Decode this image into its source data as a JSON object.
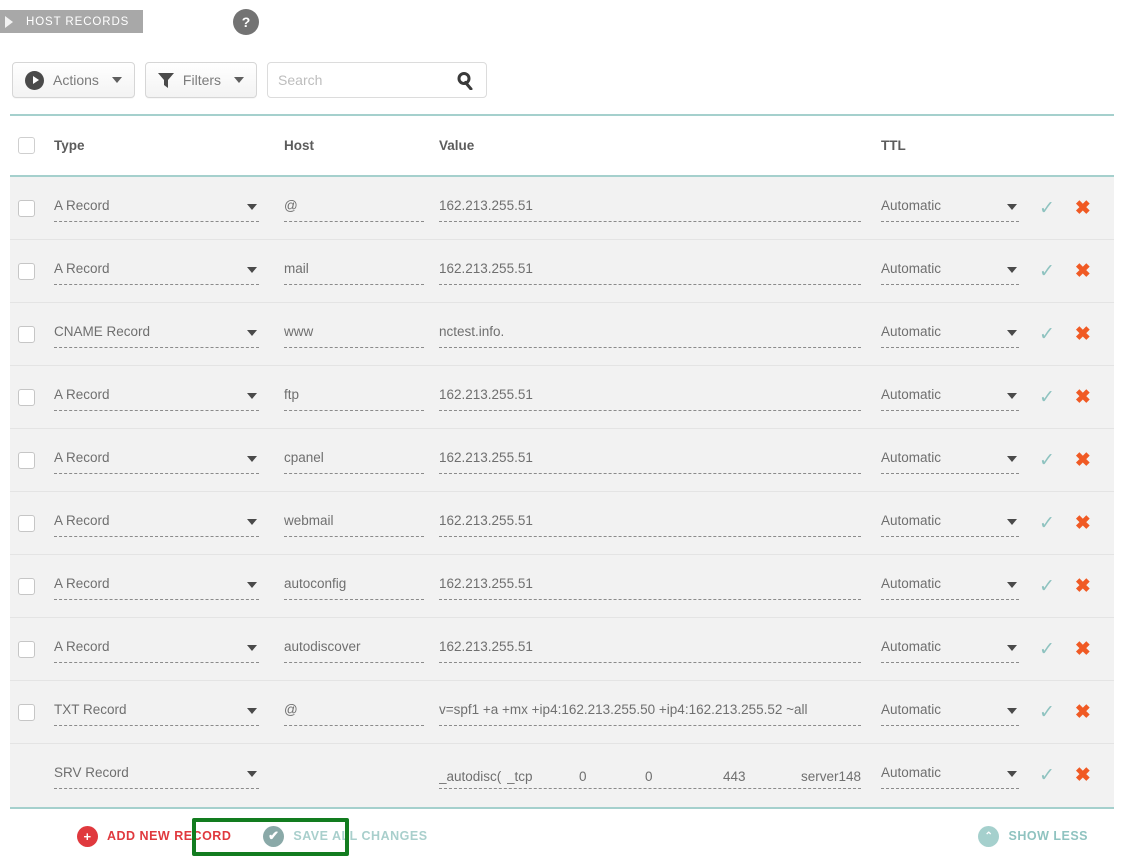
{
  "breadcrumb": {
    "label": "HOST RECORDS"
  },
  "help": {
    "label": "?"
  },
  "toolbar": {
    "actions_label": "Actions",
    "filters_label": "Filters",
    "search_placeholder": "Search",
    "search_value": ""
  },
  "table": {
    "columns": [
      "Type",
      "Host",
      "Value",
      "TTL"
    ],
    "rows": [
      {
        "checkbox": true,
        "type": "A Record",
        "host": "@",
        "value": "162.213.255.51",
        "ttl": "Automatic"
      },
      {
        "checkbox": true,
        "type": "A Record",
        "host": "mail",
        "value": "162.213.255.51",
        "ttl": "Automatic"
      },
      {
        "checkbox": true,
        "type": "CNAME Record",
        "host": "www",
        "value": "nctest.info.",
        "ttl": "Automatic"
      },
      {
        "checkbox": true,
        "type": "A Record",
        "host": "ftp",
        "value": "162.213.255.51",
        "ttl": "Automatic"
      },
      {
        "checkbox": true,
        "type": "A Record",
        "host": "cpanel",
        "value": "162.213.255.51",
        "ttl": "Automatic"
      },
      {
        "checkbox": true,
        "type": "A Record",
        "host": "webmail",
        "value": "162.213.255.51",
        "ttl": "Automatic"
      },
      {
        "checkbox": true,
        "type": "A Record",
        "host": "autoconfig",
        "value": "162.213.255.51",
        "ttl": "Automatic"
      },
      {
        "checkbox": true,
        "type": "A Record",
        "host": "autodiscover",
        "value": "162.213.255.51",
        "ttl": "Automatic"
      },
      {
        "checkbox": true,
        "type": "TXT Record",
        "host": "@",
        "value": "v=spf1 +a +mx +ip4:162.213.255.50 +ip4:162.213.255.52 ~all",
        "ttl": "Automatic"
      },
      {
        "checkbox": false,
        "type": "SRV Record",
        "host": "",
        "value": "",
        "ttl": "Automatic",
        "srv": {
          "service": "_autodisc(",
          "protocol": "_tcp",
          "priority": "0",
          "weight": "0",
          "port": "443",
          "target": "server148."
        }
      }
    ]
  },
  "footer": {
    "add_label": "ADD NEW RECORD",
    "add_icon": "+",
    "save_label": "SAVE ALL CHANGES",
    "save_icon": "✔",
    "showless_label": "SHOW LESS",
    "showless_icon": "⌃"
  },
  "colors": {
    "rule": "#a5d0cd",
    "row_bg": "#f2f2f2",
    "check": "#8fc3c0",
    "delete": "#f05a24",
    "add": "#e0393e",
    "highlight": "#127c1f",
    "crumb_bg": "#a8a8a8"
  }
}
